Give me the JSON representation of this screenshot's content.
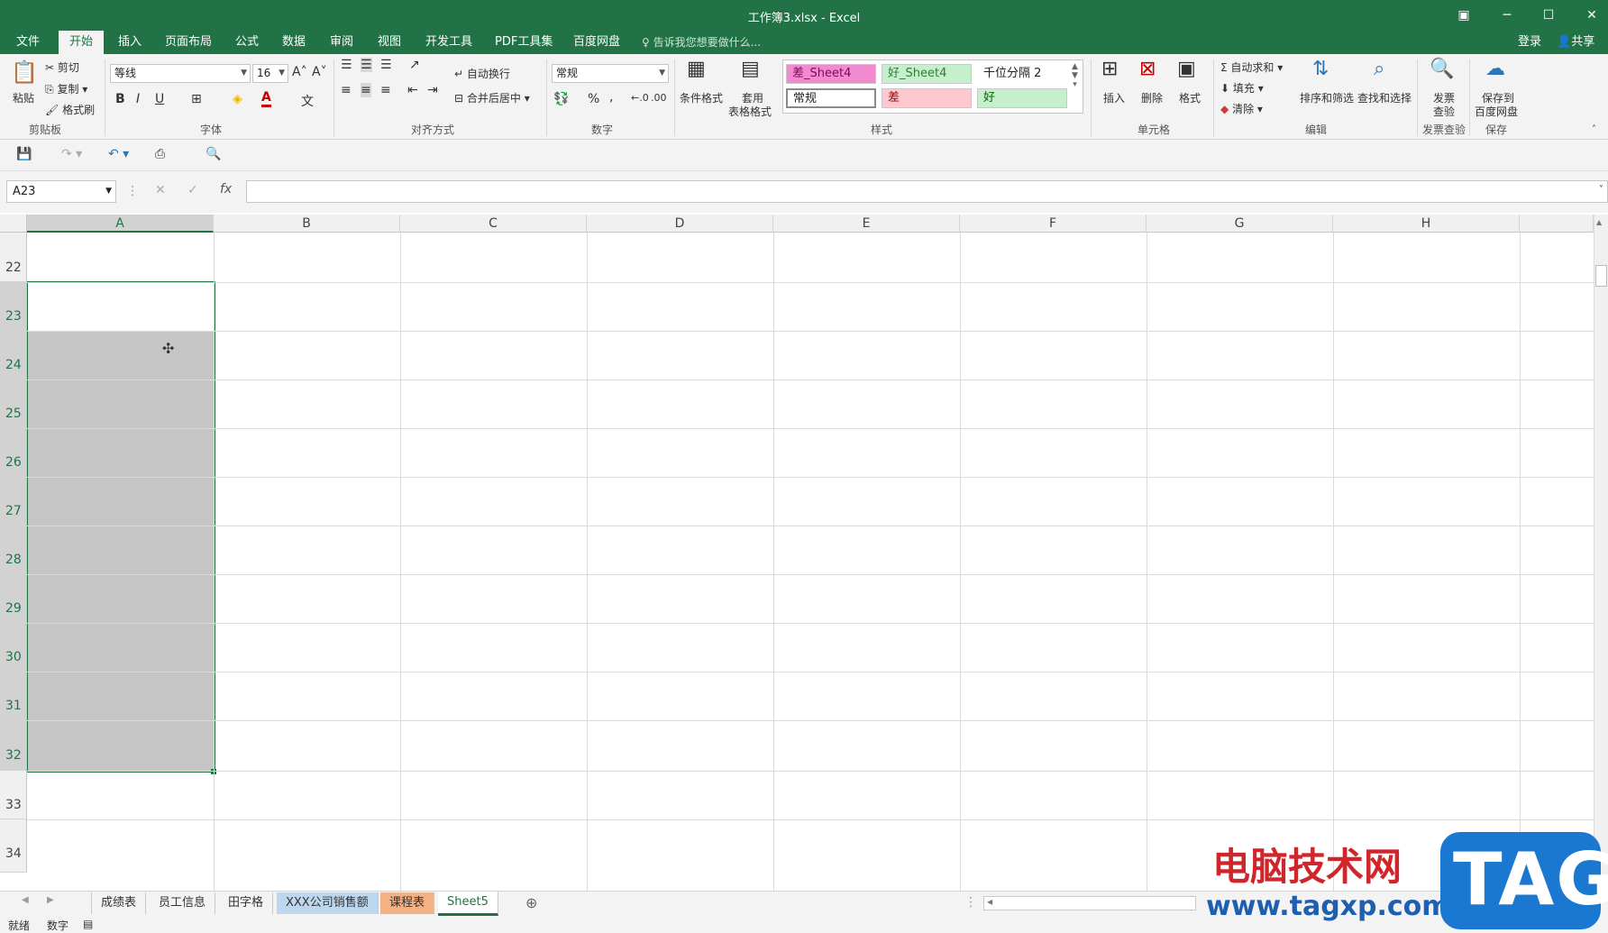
{
  "window": {
    "title": "工作簿3.xlsx - Excel",
    "login": "登录",
    "share": "共享"
  },
  "tabs": [
    "文件",
    "开始",
    "插入",
    "页面布局",
    "公式",
    "数据",
    "审阅",
    "视图",
    "开发工具",
    "PDF工具集",
    "百度网盘"
  ],
  "tell_me": "告诉我您想要做什么...",
  "ribbon": {
    "clipboard": {
      "paste": "粘贴",
      "cut": "剪切",
      "copy": "复制",
      "format_painter": "格式刷",
      "group": "剪贴板"
    },
    "font": {
      "name": "等线",
      "size": "16",
      "group": "字体",
      "bold": "B",
      "italic": "I",
      "underline": "U"
    },
    "alignment": {
      "wrap": "自动换行",
      "merge": "合并后居中",
      "group": "对齐方式"
    },
    "number": {
      "format": "常规",
      "percent": "%",
      "comma": ",",
      "group": "数字"
    },
    "styles": {
      "conditional": "条件格式",
      "table1": "套用",
      "table2": "表格格式",
      "cells": [
        "差_Sheet4",
        "好_Sheet4",
        "千位分隔 2",
        "常规",
        "差",
        "好"
      ],
      "group": "样式"
    },
    "cells": {
      "insert": "插入",
      "delete": "删除",
      "format": "格式",
      "group": "单元格"
    },
    "editing": {
      "autosum": "自动求和",
      "fill": "填充",
      "clear": "清除",
      "sort": "排序和筛选",
      "find": "查找和选择",
      "group": "编辑"
    },
    "invoice": {
      "label1": "发票",
      "label2": "查验",
      "group": "发票查验"
    },
    "save": {
      "label1": "保存到",
      "label2": "百度网盘",
      "group": "保存"
    }
  },
  "formula_bar": {
    "name_box": "A23",
    "fx": "fx",
    "value": ""
  },
  "columns": [
    "A",
    "B",
    "C",
    "D",
    "E",
    "F",
    "G",
    "H"
  ],
  "rows": [
    "22",
    "23",
    "24",
    "25",
    "26",
    "27",
    "28",
    "29",
    "30",
    "31",
    "32",
    "33",
    "34"
  ],
  "sheets": [
    "成绩表",
    "员工信息",
    "田字格",
    "XXX公司销售额",
    "课程表",
    "Sheet5"
  ],
  "status": {
    "ready": "就绪",
    "mode": "数字"
  },
  "watermark": {
    "text1": "电脑技术网",
    "url": "www.tagxp.com",
    "tag": "TAG"
  },
  "colors": {
    "excel_green": "#217346",
    "selection": "#c6c6c6"
  }
}
